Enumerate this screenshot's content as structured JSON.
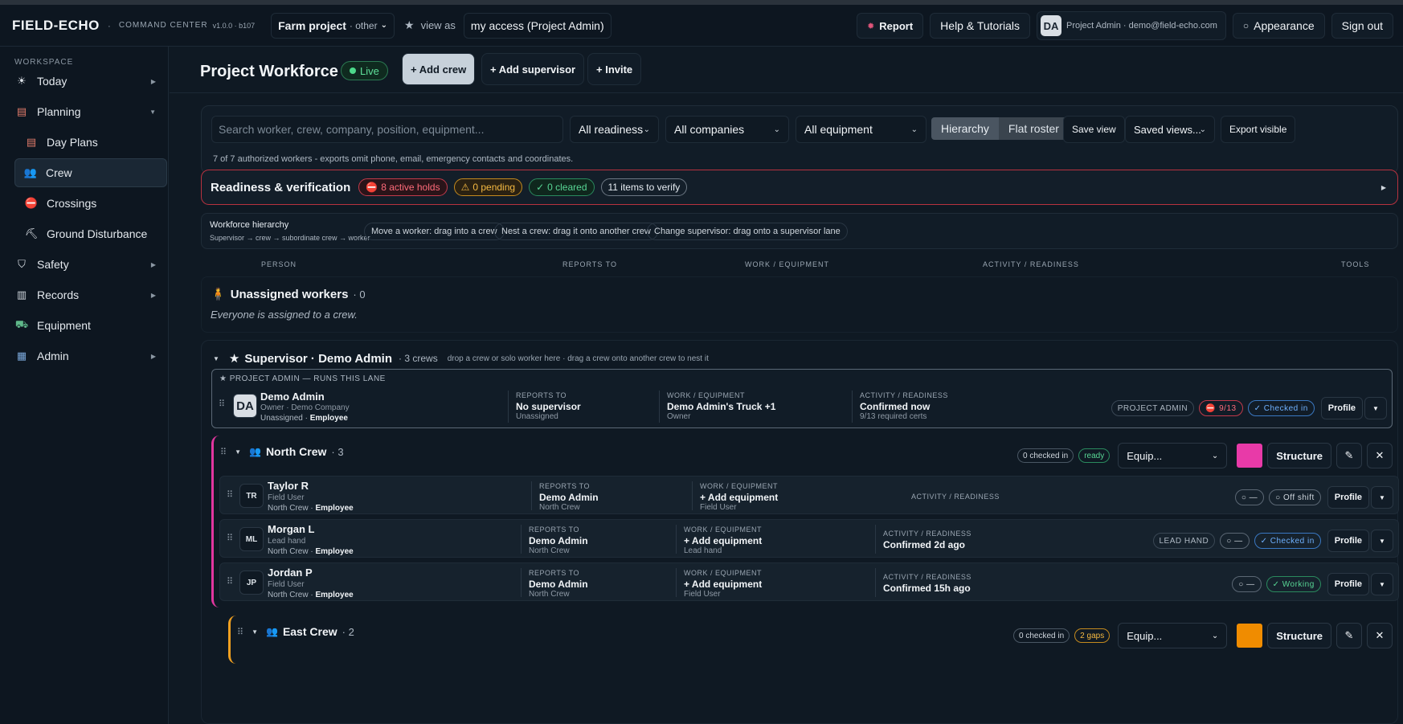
{
  "topbar": {
    "brand": "FIELD-ECHO",
    "sep": "·",
    "subtitle": "COMMAND CENTER",
    "version": "v1.0.0 · b107",
    "project": "Farm project",
    "project_sub": "· other",
    "view_as": "view as",
    "access": "my access (Project Admin)",
    "report": "Report",
    "help": "Help & Tutorials",
    "user_initials": "DA",
    "user_text": "Project Admin · demo@field-echo.com",
    "appearance": "Appearance",
    "signout": "Sign out"
  },
  "sidebar": {
    "section": "WORKSPACE",
    "items": [
      {
        "label": "Today",
        "icon": "sun-icon"
      },
      {
        "label": "Planning",
        "icon": "clipboard-icon"
      },
      {
        "label": "Day Plans",
        "icon": "clipboard-icon"
      },
      {
        "label": "Crew",
        "icon": "people-icon"
      },
      {
        "label": "Crossings",
        "icon": "no-entry-icon"
      },
      {
        "label": "Ground Disturbance",
        "icon": "pick-icon"
      },
      {
        "label": "Safety",
        "icon": "shield-icon"
      },
      {
        "label": "Records",
        "icon": "file-icon"
      },
      {
        "label": "Equipment",
        "icon": "tractor-icon"
      },
      {
        "label": "Admin",
        "icon": "building-icon"
      }
    ]
  },
  "header": {
    "title": "Project Workforce",
    "live": "Live",
    "add_crew": "+ Add crew",
    "add_supervisor": "+ Add supervisor",
    "invite": "+ Invite"
  },
  "filters": {
    "search_placeholder": "Search worker, crew, company, position, equipment...",
    "readiness": "All readiness",
    "companies": "All companies",
    "equipment": "All equipment",
    "hierarchy": "Hierarchy",
    "flat": "Flat roster",
    "save_view": "Save view",
    "saved_views": "Saved views...",
    "export": "Export visible",
    "note": "7 of 7 authorized workers - exports omit phone, email, emergency contacts and coordinates."
  },
  "readiness": {
    "title": "Readiness & verification",
    "holds": "8 active holds",
    "pending": "0 pending",
    "cleared": "0 cleared",
    "verify": "11 items to verify"
  },
  "hierarchy": {
    "title": "Workforce hierarchy",
    "sub": "Supervisor → crew → subordinate crew → worker",
    "chip1": "Move a worker: drag into a crew",
    "chip2": "Nest a crew: drag it onto another crew",
    "chip3": "Change supervisor: drag onto a supervisor lane"
  },
  "columns": {
    "person": "PERSON",
    "reports": "REPORTS TO",
    "work": "WORK / EQUIPMENT",
    "activity": "ACTIVITY / READINESS",
    "tools": "TOOLS"
  },
  "unassigned": {
    "title": "Unassigned workers",
    "count": "· 0",
    "note": "Everyone is assigned to a crew."
  },
  "lane": {
    "title": "Supervisor · Demo Admin",
    "count": "· 3 crews",
    "hint": "drop a crew or solo worker here · drag a crew onto another crew to nest it",
    "admin_label": "★ PROJECT ADMIN — RUNS THIS LANE",
    "admin": {
      "initials": "DA",
      "name": "Demo Admin",
      "role": "Owner · Demo Company",
      "crew": "Unassigned ·",
      "type": "Employee",
      "reports_label": "REPORTS TO",
      "reports": "No supervisor",
      "reports_sub": "Unassigned",
      "work_label": "WORK / EQUIPMENT",
      "work": "Demo Admin's Truck +1",
      "work_sub": "Owner",
      "activity_label": "ACTIVITY / READINESS",
      "activity": "Confirmed now",
      "activity_sub": "9/13 required certs",
      "tag": "PROJECT ADMIN",
      "certs": "9/13",
      "status": "✓ Checked in",
      "profile": "Profile"
    }
  },
  "crews": [
    {
      "name": "North Crew",
      "count": "· 3",
      "checked": "0 checked in",
      "state": "ready",
      "equip": "Equip...",
      "color": "#e83aa8",
      "structure": "Structure",
      "workers": [
        {
          "initials": "TR",
          "name": "Taylor R",
          "role": "Field User",
          "crew": "North Crew ·",
          "type": "Employee",
          "reports_label": "REPORTS TO",
          "reports": "Demo Admin",
          "reports_sub": "North Crew",
          "work_label": "WORK / EQUIPMENT",
          "work": "+ Add equipment",
          "work_sub": "Field User",
          "activity_label": "ACTIVITY / READINESS",
          "activity": "",
          "tag": "",
          "dash": "○ —",
          "status": "○ Off shift",
          "profile": "Profile"
        },
        {
          "initials": "ML",
          "name": "Morgan L",
          "role": "Lead hand",
          "crew": "North Crew ·",
          "type": "Employee",
          "reports_label": "REPORTS TO",
          "reports": "Demo Admin",
          "reports_sub": "North Crew",
          "work_label": "WORK / EQUIPMENT",
          "work": "+ Add equipment",
          "work_sub": "Lead hand",
          "activity_label": "ACTIVITY / READINESS",
          "activity": "Confirmed 2d ago",
          "tag": "LEAD HAND",
          "dash": "○ —",
          "status": "✓ Checked in",
          "profile": "Profile"
        },
        {
          "initials": "JP",
          "name": "Jordan P",
          "role": "Field User",
          "crew": "North Crew ·",
          "type": "Employee",
          "reports_label": "REPORTS TO",
          "reports": "Demo Admin",
          "reports_sub": "North Crew",
          "work_label": "WORK / EQUIPMENT",
          "work": "+ Add equipment",
          "work_sub": "Field User",
          "activity_label": "ACTIVITY / READINESS",
          "activity": "Confirmed 15h ago",
          "tag": "",
          "dash": "○ —",
          "status": "✓ Working",
          "profile": "Profile"
        }
      ]
    },
    {
      "name": "East Crew",
      "count": "· 2",
      "checked": "0 checked in",
      "state": "2 gaps",
      "equip": "Equip...",
      "color": "#f08c00",
      "structure": "Structure"
    }
  ]
}
